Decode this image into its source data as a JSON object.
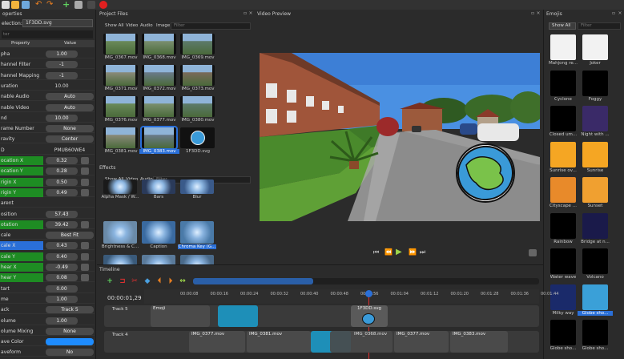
{
  "toolbar": {
    "icons": [
      "new-project-icon",
      "open-project-icon",
      "save-project-icon",
      "undo-icon",
      "redo-icon",
      "add-file-icon",
      "choose-profile-icon",
      "export-icon"
    ]
  },
  "properties": {
    "title": "operties",
    "selection_label": "election:",
    "selection_value": "1F3DD.svg",
    "filter_placeholder": "ter",
    "col_property": "Property",
    "col_value": "Value",
    "rows": [
      {
        "name": "pha",
        "value": "1.00",
        "style": "pill",
        "color": ""
      },
      {
        "name": "hannel Filter",
        "value": "-1",
        "style": "pill",
        "color": ""
      },
      {
        "name": "hannel Mapping",
        "value": "-1",
        "style": "pill",
        "color": ""
      },
      {
        "name": "uration",
        "value": "10.00",
        "style": "plain",
        "color": ""
      },
      {
        "name": "nable Audio",
        "value": "Auto",
        "style": "pill",
        "color": ""
      },
      {
        "name": "nable Video",
        "value": "Auto",
        "style": "pill",
        "color": ""
      },
      {
        "name": "nd",
        "value": "10.00",
        "style": "pill",
        "color": ""
      },
      {
        "name": "rame Number",
        "value": "None",
        "style": "pill",
        "color": ""
      },
      {
        "name": "ravity",
        "value": "Center",
        "style": "pill",
        "color": ""
      },
      {
        "name": "D",
        "value": "PMUB60WE4",
        "style": "plain",
        "color": ""
      },
      {
        "name": "ocation X",
        "value": "0.32",
        "style": "pill",
        "color": "green"
      },
      {
        "name": "ocation Y",
        "value": "0.28",
        "style": "pill",
        "color": "green"
      },
      {
        "name": "rigin X",
        "value": "0.50",
        "style": "pill",
        "color": "green"
      },
      {
        "name": "rigin Y",
        "value": "0.49",
        "style": "pill",
        "color": "green"
      },
      {
        "name": "arent",
        "value": "",
        "style": "plain",
        "color": ""
      },
      {
        "name": "osition",
        "value": "57.43",
        "style": "pill",
        "color": ""
      },
      {
        "name": "otation",
        "value": "39.42",
        "style": "pill",
        "color": "green"
      },
      {
        "name": "cale",
        "value": "Best Fit",
        "style": "pill",
        "color": ""
      },
      {
        "name": "cale X",
        "value": "0.43",
        "style": "pill",
        "color": "blue"
      },
      {
        "name": "cale Y",
        "value": "0.40",
        "style": "pill",
        "color": "green"
      },
      {
        "name": "hear X",
        "value": "-0.49",
        "style": "pill",
        "color": "green"
      },
      {
        "name": "hear Y",
        "value": "0.08",
        "style": "pill",
        "color": "green"
      },
      {
        "name": "tart",
        "value": "0.00",
        "style": "pill",
        "color": ""
      },
      {
        "name": "me",
        "value": "1.00",
        "style": "pill",
        "color": ""
      },
      {
        "name": "ack",
        "value": "Track 5",
        "style": "pill",
        "color": ""
      },
      {
        "name": "olume",
        "value": "1.00",
        "style": "pill",
        "color": ""
      },
      {
        "name": "olume Mixing",
        "value": "None",
        "style": "pill",
        "color": ""
      },
      {
        "name": "ave Color",
        "value": "",
        "style": "swatch",
        "color": ""
      },
      {
        "name": "aveform",
        "value": "No",
        "style": "pill",
        "color": ""
      }
    ]
  },
  "project_files": {
    "title": "Project Files",
    "tabs": [
      "Show All",
      "Video",
      "Audio",
      "Image"
    ],
    "filter_placeholder": "Filter",
    "files": [
      "IMG_0367.mov",
      "IMG_0368.mov",
      "IMG_0369.mov",
      "IMG_0371.mov",
      "IMG_0372.mov",
      "IMG_0373.mov",
      "IMG_0376.mov",
      "IMG_0377.mov",
      "IMG_0380.mov",
      "IMG_0381.mov",
      "IMG_0383.mov",
      "1F3DD.svg"
    ]
  },
  "effects": {
    "title": "Effects",
    "tabs": [
      "Show All",
      "Video",
      "Audio"
    ],
    "filter_placeholder": "Filter",
    "items": [
      "Alpha Mask / W...",
      "Bars",
      "Blur",
      "Brightness & C...",
      "Caption",
      "Chroma Key (G...",
      "",
      "",
      ""
    ]
  },
  "preview": {
    "title": "Video Preview"
  },
  "emojis": {
    "title": "Emojis",
    "dropdown": "Show All",
    "filter_placeholder": "Filter",
    "items": [
      {
        "label": "Mahjong re...",
        "bg": "#f2f2f2"
      },
      {
        "label": "Joker",
        "bg": "#f2f2f2"
      },
      {
        "label": "Cyclone",
        "bg": "#000000"
      },
      {
        "label": "Foggy",
        "bg": "#000000"
      },
      {
        "label": "Closed um...",
        "bg": "#000000"
      },
      {
        "label": "Night with ...",
        "bg": "#3a2a68"
      },
      {
        "label": "Sunrise ov...",
        "bg": "#f5a623"
      },
      {
        "label": "Sunrise",
        "bg": "#f5a623"
      },
      {
        "label": "Cityscape ...",
        "bg": "#e88a2a"
      },
      {
        "label": "Sunset",
        "bg": "#f0a030"
      },
      {
        "label": "Rainbow",
        "bg": "#000000"
      },
      {
        "label": "Bridge at n...",
        "bg": "#1a1a4a"
      },
      {
        "label": "Water wave",
        "bg": "#000000"
      },
      {
        "label": "Volcano",
        "bg": "#000000"
      },
      {
        "label": "Milky way",
        "bg": "#1a2a6a"
      },
      {
        "label": "Globe sho...",
        "bg": "#3aa0d8"
      },
      {
        "label": "Globe sho...",
        "bg": "#000000"
      },
      {
        "label": "Globe sho...",
        "bg": "#000000"
      }
    ]
  },
  "timeline": {
    "title": "Timeline",
    "timecode": "00:00:01,29",
    "ruler": [
      "00:00:08",
      "00:00:16",
      "00:00:24",
      "00:00:32",
      "00:00:40",
      "00:00:48",
      "00:00:56",
      "00:01:04",
      "00:01:12",
      "00:01:20",
      "00:01:28",
      "00:01:36",
      "00:01:44"
    ],
    "track5": {
      "label": "Track 5",
      "clip1": "Emoji",
      "clip2": "1F3DD.svg"
    },
    "track4": {
      "label": "Track 4",
      "clips": [
        "IMG_0377.mov",
        "IMG_0381.mov",
        "IMG_0368.mov",
        "IMG_0377.mov",
        "IMG_0383.mov"
      ]
    }
  }
}
